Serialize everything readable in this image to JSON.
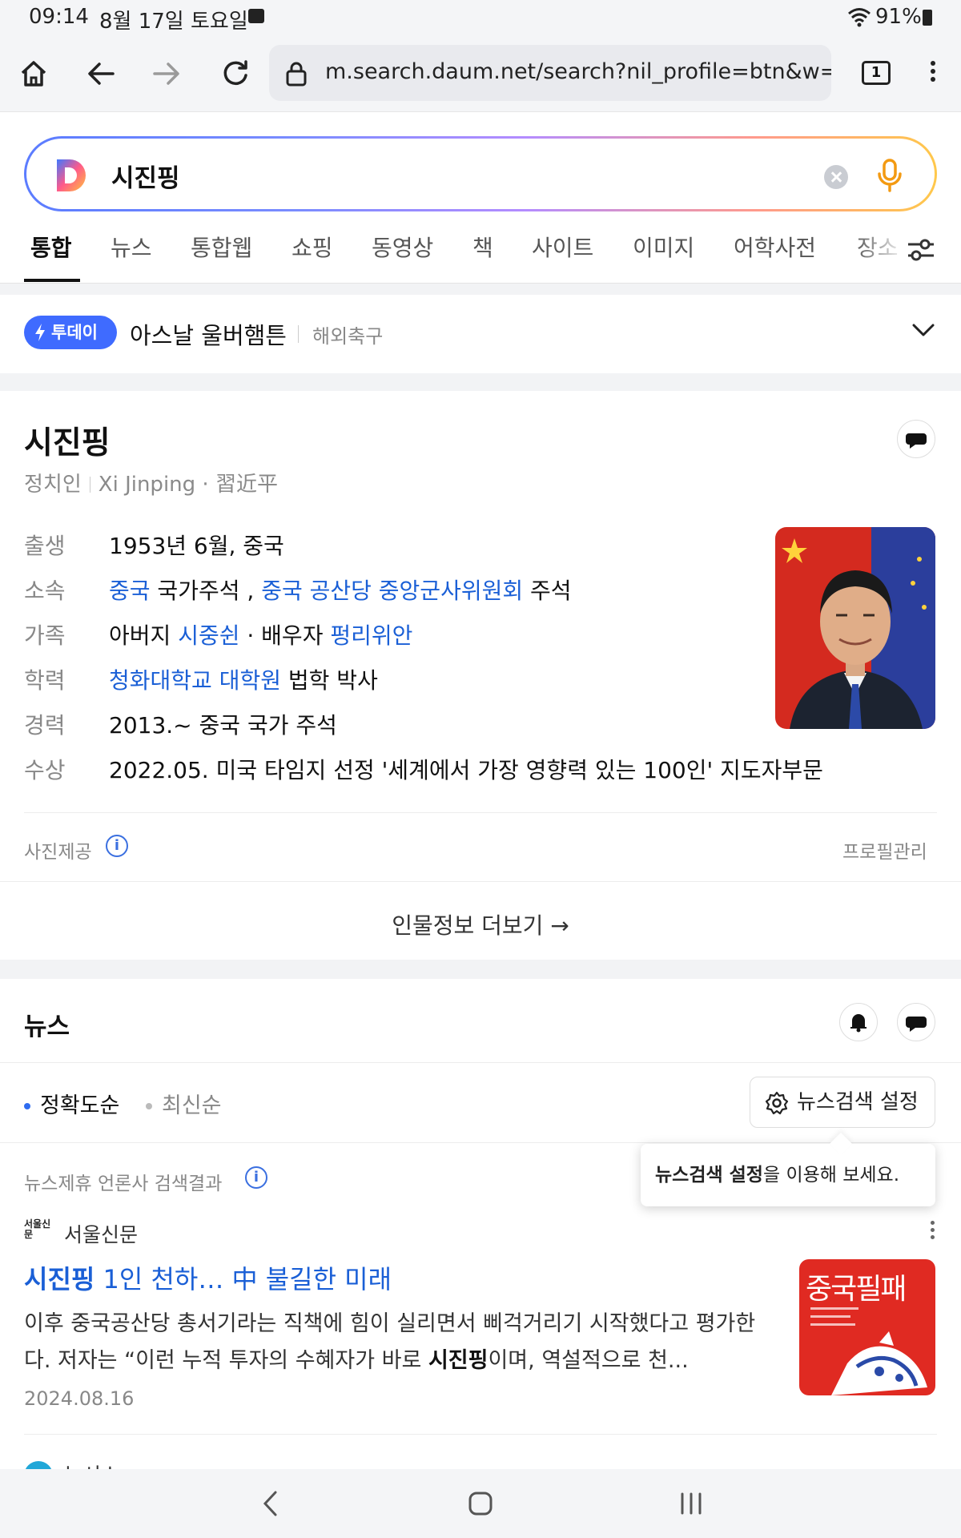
{
  "status_bar": {
    "time": "09:14",
    "date": "8월 17일 토요일",
    "battery": "91%"
  },
  "browser": {
    "url": "m.search.daum.net/search?nil_profile=btn&w=tot&",
    "tab_count": "1"
  },
  "search": {
    "query": "시진핑"
  },
  "tabs": [
    {
      "label": "통합",
      "active": true
    },
    {
      "label": "뉴스"
    },
    {
      "label": "통합웹"
    },
    {
      "label": "쇼핑"
    },
    {
      "label": "동영상"
    },
    {
      "label": "책"
    },
    {
      "label": "사이트"
    },
    {
      "label": "이미지"
    },
    {
      "label": "어학사전"
    },
    {
      "label": "장소"
    }
  ],
  "today": {
    "badge": "투데이",
    "topic": "아스날 울버햄튼",
    "category": "해외축구"
  },
  "profile": {
    "name": "시진핑",
    "occupation": "정치인",
    "romanized": "Xi Jinping · 習近平",
    "rows": {
      "birth": {
        "label": "출생",
        "value": "1953년 6월, 중국"
      },
      "affiliation": {
        "label": "소속",
        "link1": "중국",
        "text1": " 국가주석 , ",
        "link2": "중국 공산당 중앙군사위원회",
        "text2": " 주석"
      },
      "family": {
        "label": "가족",
        "text1": "아버지 ",
        "link1": "시중쉰",
        "text2": " · 배우자 ",
        "link2": "펑리위안"
      },
      "education": {
        "label": "학력",
        "link1": "청화대학교 대학원",
        "text1": " 법학 박사"
      },
      "career": {
        "label": "경력",
        "value": "2013.~ 중국 국가 주석"
      },
      "award": {
        "label": "수상",
        "value": "2022.05. 미국 타임지 선정 '세계에서 가장 영향력 있는 100인' 지도자부문"
      }
    },
    "photo_credit": "사진제공",
    "manage": "프로필관리",
    "more": "인물정보 더보기 →"
  },
  "news": {
    "title": "뉴스",
    "sort_accuracy": "정확도순",
    "sort_latest": "최신순",
    "settings_button": "뉴스검색 설정",
    "partner_label": "뉴스제휴 언론사 검색결과",
    "tooltip_bold": "뉴스검색 설정",
    "tooltip_rest": "을 이용해 보세요.",
    "article": {
      "source_logo": "서울신문",
      "source": "서울신문",
      "title_bold": "시진핑",
      "title_rest": " 1인 천하… 中 불길한 미래",
      "snippet_1": "이후 중국공산당 총서기라는 직책에 힘이 실리면서 삐걱거리기 시작했다고 평가한다. 저자는 “이런 누적 투자의 수혜자가 바로 ",
      "snippet_bold": "시진핑",
      "snippet_2": "이며, 역설적으로 천...",
      "date": "2024.08.16",
      "thumb_title": "중국필패"
    },
    "next_source": "뉴시스"
  },
  "colors": {
    "link": "#1a5fd6",
    "today_badge": "#3f6bff"
  }
}
